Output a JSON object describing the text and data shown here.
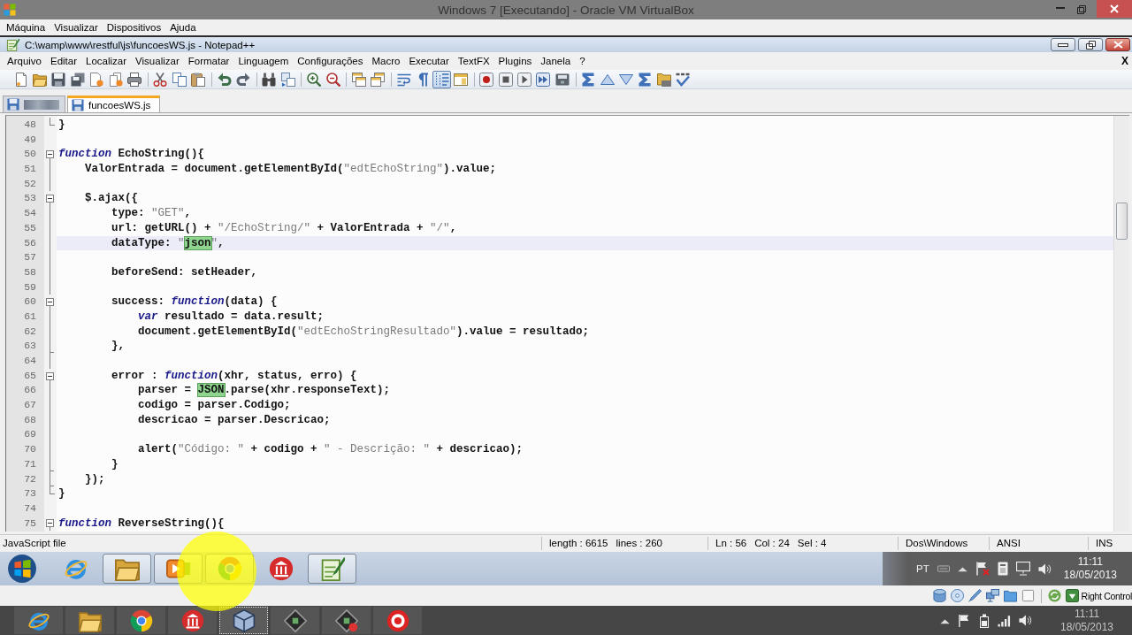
{
  "vbox_window": {
    "title": "Windows 7 [Executando] - Oracle VM VirtualBox",
    "menu": [
      "Máquina",
      "Visualizar",
      "Dispositivos",
      "Ajuda"
    ]
  },
  "notepad_window": {
    "title": "C:\\wamp\\www\\restful\\js\\funcoesWS.js - Notepad++",
    "menu": [
      "Arquivo",
      "Editar",
      "Localizar",
      "Visualizar",
      "Formatar",
      "Linguagem",
      "Configurações",
      "Macro",
      "Executar",
      "TextFX",
      "Plugins",
      "Janela",
      "?"
    ],
    "close_document": "X"
  },
  "toolbar": [
    [
      {
        "pressed": false
      },
      {
        "pressed": false
      },
      {
        "pressed": false
      },
      {
        "pressed": false
      },
      {
        "pressed": false
      },
      {
        "pressed": false
      },
      {
        "pressed": false
      }
    ],
    [
      {
        "pressed": false
      },
      {
        "pressed": false
      },
      {
        "pressed": false
      }
    ],
    [
      {
        "pressed": false
      },
      {
        "pressed": false
      }
    ],
    [
      {
        "pressed": false
      },
      {
        "pressed": false
      }
    ],
    [
      {
        "pressed": false
      },
      {
        "pressed": false
      }
    ],
    [
      {
        "pressed": false
      },
      {
        "pressed": false
      }
    ],
    [
      {
        "pressed": false
      },
      {
        "pressed": false
      },
      {
        "pressed": true
      },
      {
        "pressed": false
      }
    ],
    [
      {
        "pressed": false
      },
      {
        "pressed": false
      },
      {
        "pressed": false
      },
      {
        "pressed": false
      },
      {
        "pressed": false
      }
    ],
    [
      {
        "pressed": false
      },
      {
        "pressed": false
      },
      {
        "pressed": false
      },
      {
        "pressed": false
      },
      {
        "pressed": false
      },
      {
        "pressed": false
      }
    ]
  ],
  "tabs": [
    {
      "selected": false
    },
    {
      "label": "funcoesWS.js",
      "selected": true
    }
  ],
  "editor": {
    "lines": [
      {
        "number": "48",
        "kind": "fold_end",
        "current": false,
        "segments": [
          {
            "kind": "plain",
            "text": "}"
          }
        ]
      },
      {
        "number": "49",
        "kind": "plain",
        "current": false
      },
      {
        "number": "50",
        "kind": "fold_open",
        "current": false,
        "segments": [
          {
            "kind": "keyword",
            "text": "function"
          },
          {
            "kind": "plain",
            "text": " EchoString(){"
          }
        ]
      },
      {
        "number": "51",
        "kind": "fold_line",
        "current": false,
        "segments": [
          {
            "kind": "plain",
            "text": "    ValorEntrada = document.getElementById("
          },
          {
            "kind": "string",
            "text": "\"edtEchoString\""
          },
          {
            "kind": "plain",
            "text": ").value;"
          }
        ]
      },
      {
        "number": "52",
        "kind": "fold_line",
        "current": false
      },
      {
        "number": "53",
        "kind": "fold_open",
        "current": false,
        "segments": [
          {
            "kind": "plain",
            "text": "    $.ajax({"
          }
        ]
      },
      {
        "number": "54",
        "kind": "fold_line",
        "current": false,
        "segments": [
          {
            "kind": "plain",
            "text": "        type: "
          },
          {
            "kind": "string",
            "text": "\"GET\""
          },
          {
            "kind": "plain",
            "text": ","
          }
        ]
      },
      {
        "number": "55",
        "kind": "fold_line",
        "current": false,
        "segments": [
          {
            "kind": "plain",
            "text": "        url: getURL() + "
          },
          {
            "kind": "string",
            "text": "\"/EchoString/\""
          },
          {
            "kind": "plain",
            "text": " + ValorEntrada + "
          },
          {
            "kind": "string",
            "text": "\"/\""
          },
          {
            "kind": "plain",
            "text": ","
          }
        ]
      },
      {
        "number": "56",
        "kind": "fold_line",
        "current": true,
        "segments": [
          {
            "kind": "plain",
            "text": "        dataType: "
          },
          {
            "kind": "string",
            "text": "\""
          },
          {
            "kind": "match",
            "text": "json"
          },
          {
            "kind": "caret"
          },
          {
            "kind": "string",
            "text": "\""
          },
          {
            "kind": "plain",
            "text": ","
          }
        ]
      },
      {
        "number": "57",
        "kind": "fold_line",
        "current": false
      },
      {
        "number": "58",
        "kind": "fold_line",
        "current": false,
        "segments": [
          {
            "kind": "plain",
            "text": "        beforeSend: setHeader,"
          }
        ]
      },
      {
        "number": "59",
        "kind": "fold_line",
        "current": false
      },
      {
        "number": "60",
        "kind": "fold_open",
        "current": false,
        "segments": [
          {
            "kind": "plain",
            "text": "        success: "
          },
          {
            "kind": "keyword",
            "text": "function"
          },
          {
            "kind": "plain",
            "text": "(data) {"
          }
        ]
      },
      {
        "number": "61",
        "kind": "fold_line",
        "current": false,
        "segments": [
          {
            "kind": "keyword",
            "text": "            var"
          },
          {
            "kind": "plain",
            "text": " resultado = data.result;"
          }
        ]
      },
      {
        "number": "62",
        "kind": "fold_line",
        "current": false,
        "segments": [
          {
            "kind": "plain",
            "text": "            document.getElementById("
          },
          {
            "kind": "string",
            "text": "\"edtEchoStringResultado\""
          },
          {
            "kind": "plain",
            "text": ").value = resultado;"
          }
        ]
      },
      {
        "number": "63",
        "kind": "fold_tick",
        "current": false,
        "segments": [
          {
            "kind": "plain",
            "text": "        },"
          }
        ]
      },
      {
        "number": "64",
        "kind": "fold_line",
        "current": false
      },
      {
        "number": "65",
        "kind": "fold_open",
        "current": false,
        "segments": [
          {
            "kind": "plain",
            "text": "        error : "
          },
          {
            "kind": "keyword",
            "text": "function"
          },
          {
            "kind": "plain",
            "text": "(xhr, status, erro) {"
          }
        ]
      },
      {
        "number": "66",
        "kind": "fold_line",
        "current": false,
        "segments": [
          {
            "kind": "plain",
            "text": "            parser = "
          },
          {
            "kind": "match",
            "text": "JSON"
          },
          {
            "kind": "plain",
            "text": ".parse(xhr.responseText);"
          }
        ]
      },
      {
        "number": "67",
        "kind": "fold_line",
        "current": false,
        "segments": [
          {
            "kind": "plain",
            "text": "            codigo = parser.Codigo;"
          }
        ]
      },
      {
        "number": "68",
        "kind": "fold_line",
        "current": false,
        "segments": [
          {
            "kind": "plain",
            "text": "            descricao = parser.Descricao;"
          }
        ]
      },
      {
        "number": "69",
        "kind": "fold_line",
        "current": false
      },
      {
        "number": "70",
        "kind": "fold_line",
        "current": false,
        "segments": [
          {
            "kind": "plain",
            "text": "            alert("
          },
          {
            "kind": "string",
            "text": "\"Código: \""
          },
          {
            "kind": "plain",
            "text": " + codigo + "
          },
          {
            "kind": "string",
            "text": "\" - Descrição: \""
          },
          {
            "kind": "plain",
            "text": " + descricao);"
          }
        ]
      },
      {
        "number": "71",
        "kind": "fold_tick",
        "current": false,
        "segments": [
          {
            "kind": "plain",
            "text": "        }"
          }
        ]
      },
      {
        "number": "72",
        "kind": "fold_tick",
        "current": false,
        "segments": [
          {
            "kind": "plain",
            "text": "    });"
          }
        ]
      },
      {
        "number": "73",
        "kind": "fold_end",
        "current": false,
        "segments": [
          {
            "kind": "plain",
            "text": "}"
          }
        ]
      },
      {
        "number": "74",
        "kind": "plain",
        "current": false
      },
      {
        "number": "75",
        "kind": "fold_open",
        "current": false,
        "segments": [
          {
            "kind": "keyword",
            "text": "function"
          },
          {
            "kind": "plain",
            "text": " ReverseString(){"
          }
        ]
      }
    ]
  },
  "status_bar": [
    {
      "texts": [
        "JavaScript file"
      ]
    },
    {
      "texts": [
        "length : 6615",
        "lines : 260"
      ]
    },
    {
      "texts": [
        "Ln : 56",
        "Col : 24",
        "Sel : 4"
      ]
    },
    {
      "texts": [
        "Dos\\Windows"
      ]
    },
    {
      "texts": [
        "ANSI"
      ]
    },
    {
      "texts": [
        "INS"
      ]
    }
  ],
  "guest_taskbar": {
    "items": [
      {
        "open": false
      },
      {
        "open": true
      },
      {
        "open": true
      },
      {
        "open": true
      },
      {
        "open": false
      },
      {
        "open": true
      }
    ],
    "language": "PT",
    "time": "11:11",
    "date": "18/05/2013"
  },
  "vbox_status": {
    "host_key": "Right Control"
  },
  "host_taskbar": {
    "items": [
      {
        "selected": false
      },
      {
        "selected": false
      },
      {
        "selected": false
      },
      {
        "selected": false
      },
      {
        "selected": true
      },
      {
        "selected": false
      },
      {
        "selected": false
      },
      {
        "selected": false
      }
    ],
    "time": "11:11",
    "date": "18/05/2013"
  }
}
